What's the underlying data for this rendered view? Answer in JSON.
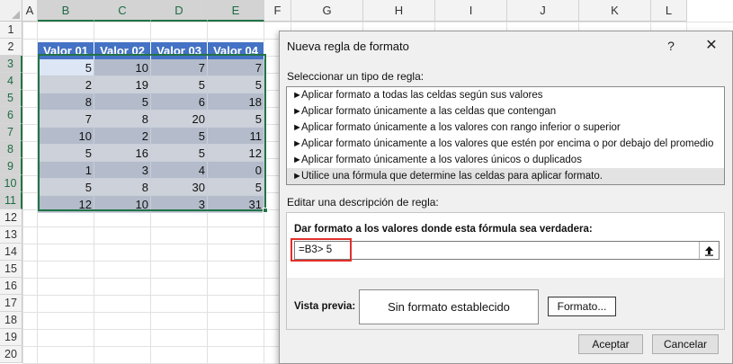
{
  "sheet": {
    "columns": [
      "A",
      "B",
      "C",
      "D",
      "E",
      "F",
      "G",
      "H",
      "I",
      "J",
      "K",
      "L"
    ],
    "rows": [
      "1",
      "2",
      "3",
      "4",
      "5",
      "6",
      "7",
      "8",
      "9",
      "10",
      "11",
      "12",
      "13",
      "14",
      "15",
      "16",
      "17",
      "18",
      "19",
      "20"
    ],
    "selected_columns": [
      "B",
      "C",
      "D",
      "E"
    ],
    "selected_rows": [
      "3",
      "4",
      "5",
      "6",
      "7",
      "8",
      "9",
      "10",
      "11"
    ],
    "table": {
      "headers": [
        "Valor 01",
        "Valor 02",
        "Valor 03",
        "Valor 04"
      ],
      "rows": [
        [
          "5",
          "10",
          "7",
          "7"
        ],
        [
          "2",
          "19",
          "5",
          "5"
        ],
        [
          "8",
          "5",
          "6",
          "18"
        ],
        [
          "7",
          "8",
          "20",
          "5"
        ],
        [
          "10",
          "2",
          "5",
          "11"
        ],
        [
          "5",
          "16",
          "5",
          "12"
        ],
        [
          "1",
          "3",
          "4",
          "0"
        ],
        [
          "5",
          "8",
          "30",
          "5"
        ],
        [
          "12",
          "10",
          "3",
          "31"
        ]
      ]
    },
    "colors": {
      "header_bg": "#4472c4",
      "band_dark": "#b4bccb",
      "band_light": "#cdd1d9",
      "selection": "#217346"
    }
  },
  "dialog": {
    "title": "Nueva regla de formato",
    "help_label": "?",
    "close_icon": "close-icon",
    "select_type_label": "Seleccionar un tipo de regla:",
    "rule_types": [
      "Aplicar formato a todas las celdas según sus valores",
      "Aplicar formato únicamente a las celdas que contengan",
      "Aplicar formato únicamente a los valores con rango inferior o superior",
      "Aplicar formato únicamente a los valores que estén por encima o por debajo del promedio",
      "Aplicar formato únicamente a los valores únicos o duplicados",
      "Utilice una fórmula que determine las celdas para aplicar formato."
    ],
    "selected_rule_index": 5,
    "edit_description_label": "Editar una descripción de regla:",
    "formula_label": "Dar formato a los valores donde esta fórmula sea verdadera:",
    "formula_value": "=B3> 5",
    "preview_label": "Vista previa:",
    "preview_text": "Sin formato establecido",
    "format_button": "Formato...",
    "ok_button": "Aceptar",
    "cancel_button": "Cancelar",
    "highlight_color": "#e0302a"
  }
}
